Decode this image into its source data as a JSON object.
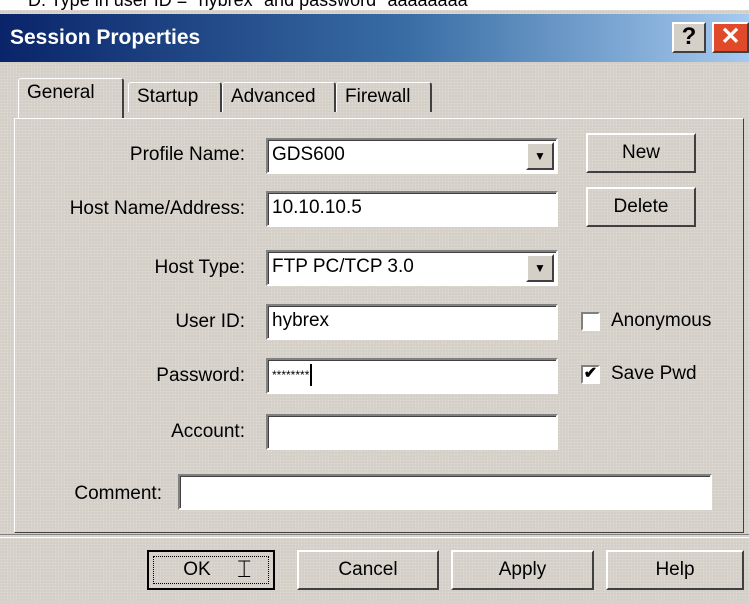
{
  "caption": "D.     Type in user ID = \"hybrex\" and password \"aaaaaaaa\"",
  "window": {
    "title": "Session Properties",
    "help_glyph": "?",
    "close_glyph": "✕"
  },
  "tabs": [
    {
      "label": "General",
      "active": true
    },
    {
      "label": "Startup",
      "active": false
    },
    {
      "label": "Advanced",
      "active": false
    },
    {
      "label": "Firewall",
      "active": false
    }
  ],
  "form": {
    "profile_name": {
      "label": "Profile Name:",
      "value": "GDS600"
    },
    "host_name": {
      "label": "Host Name/Address:",
      "value": "10.10.10.5"
    },
    "host_type": {
      "label": "Host Type:",
      "value": "FTP PC/TCP 3.0"
    },
    "user_id": {
      "label": "User ID:",
      "value": "hybrex"
    },
    "password": {
      "label": "Password:",
      "value": "********"
    },
    "account": {
      "label": "Account:",
      "value": ""
    },
    "comment": {
      "label": "Comment:",
      "value": ""
    }
  },
  "side_buttons": {
    "new": "New",
    "delete": "Delete"
  },
  "checkboxes": {
    "anonymous": {
      "label": "Anonymous",
      "checked": false,
      "mark": ""
    },
    "save_pwd": {
      "label": "Save Pwd",
      "checked": true,
      "mark": "✔"
    }
  },
  "bottom_buttons": {
    "ok": "OK",
    "cancel": "Cancel",
    "apply": "Apply",
    "help": "Help"
  },
  "colors": {
    "titlebar_start": "#0a246a",
    "titlebar_end": "#a6caf0",
    "close_button": "#e04a2a"
  }
}
